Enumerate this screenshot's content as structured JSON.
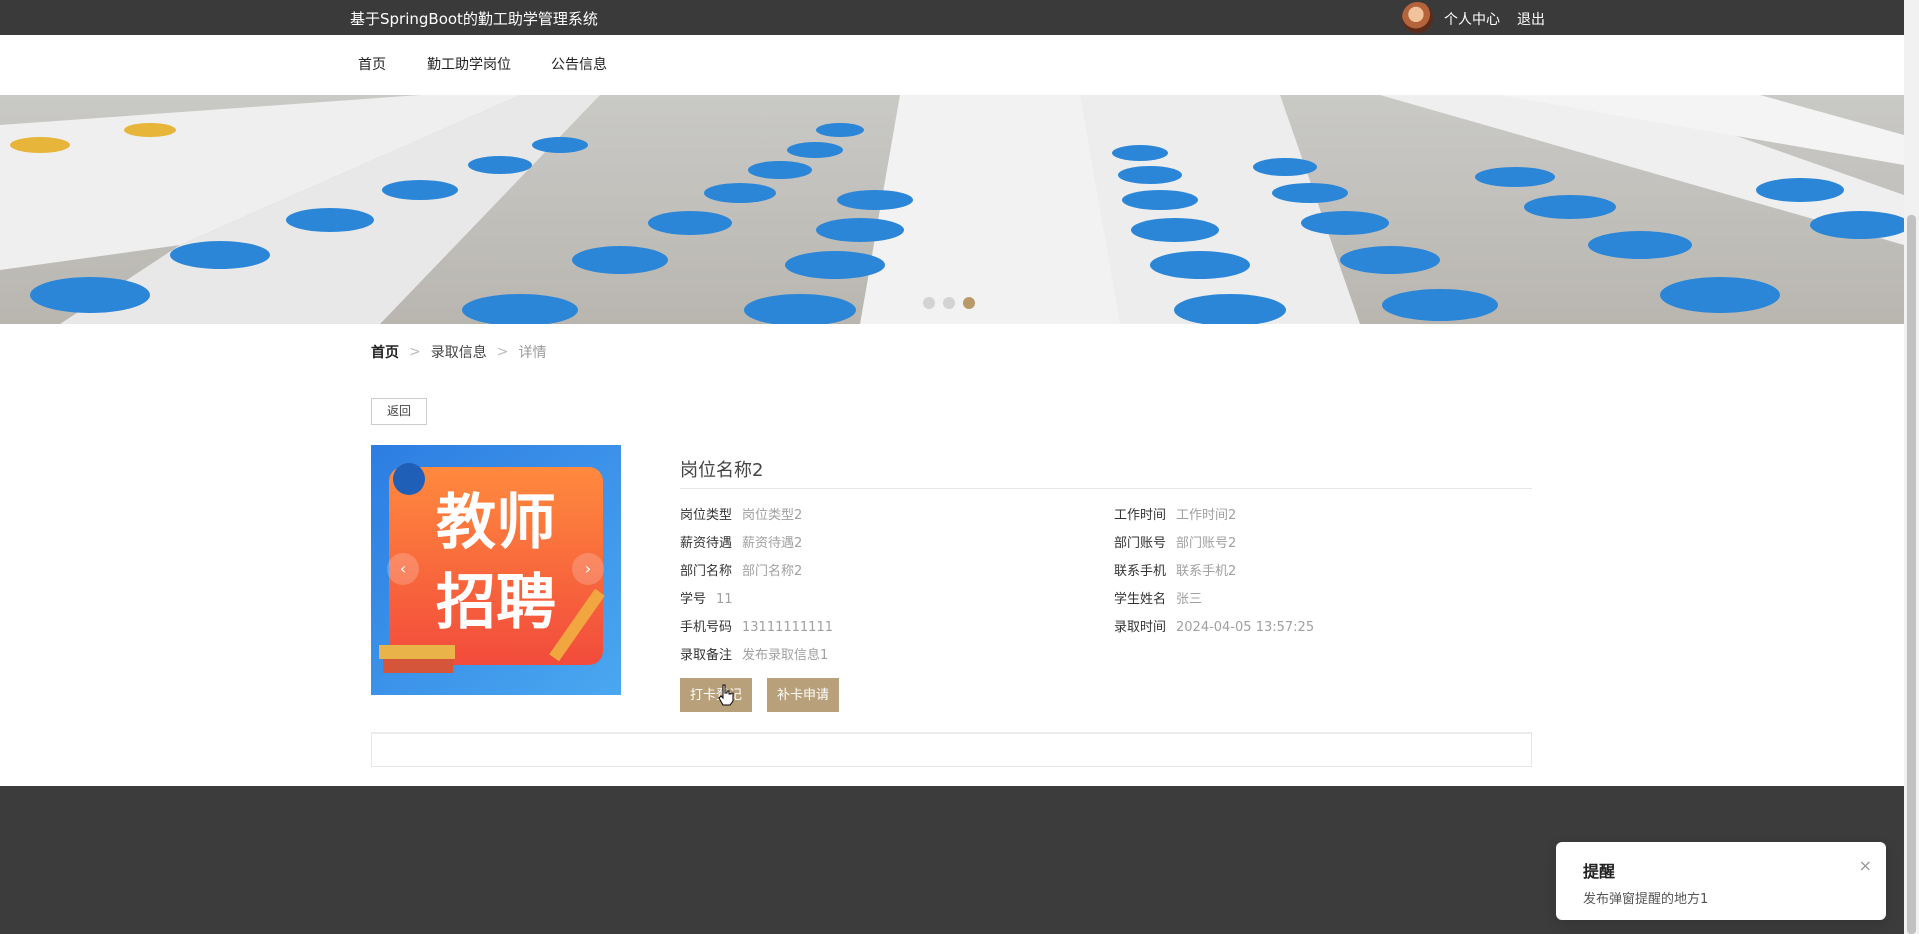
{
  "header": {
    "title": "基于SpringBoot的勤工助学管理系统",
    "user_center": "个人中心",
    "logout": "退出"
  },
  "nav": {
    "items": [
      "首页",
      "勤工助学岗位",
      "公告信息"
    ]
  },
  "carousel": {
    "slide_count": 3,
    "active_index": 2
  },
  "breadcrumb": {
    "home": "首页",
    "section": "录取信息",
    "current": "详情",
    "separator": ">"
  },
  "back_button": "返回",
  "poster": {
    "line1": "教师",
    "line2": "招聘",
    "prev": "‹",
    "next": "›"
  },
  "detail": {
    "title": "岗位名称2",
    "left": [
      {
        "label": "岗位类型",
        "value": "岗位类型2"
      },
      {
        "label": "薪资待遇",
        "value": "薪资待遇2"
      },
      {
        "label": "部门名称",
        "value": "部门名称2"
      },
      {
        "label": "学号",
        "value": "11"
      },
      {
        "label": "手机号码",
        "value": "13111111111"
      },
      {
        "label": "录取备注",
        "value": "发布录取信息1"
      }
    ],
    "right": [
      {
        "label": "工作时间",
        "value": "工作时间2"
      },
      {
        "label": "部门账号",
        "value": "部门账号2"
      },
      {
        "label": "联系手机",
        "value": "联系手机2"
      },
      {
        "label": "学生姓名",
        "value": "张三"
      },
      {
        "label": "录取时间",
        "value": "2024-04-05 13:57:25"
      }
    ],
    "buttons": {
      "checkin": "打卡登记",
      "makeup": "补卡申请"
    }
  },
  "toast": {
    "title": "提醒",
    "message": "发布弹窗提醒的地方1",
    "close": "×"
  },
  "colors": {
    "topbar": "#3a3a3a",
    "accent": "#b38f5b",
    "button": "#b8a07a",
    "footer": "#3c3c3c"
  }
}
